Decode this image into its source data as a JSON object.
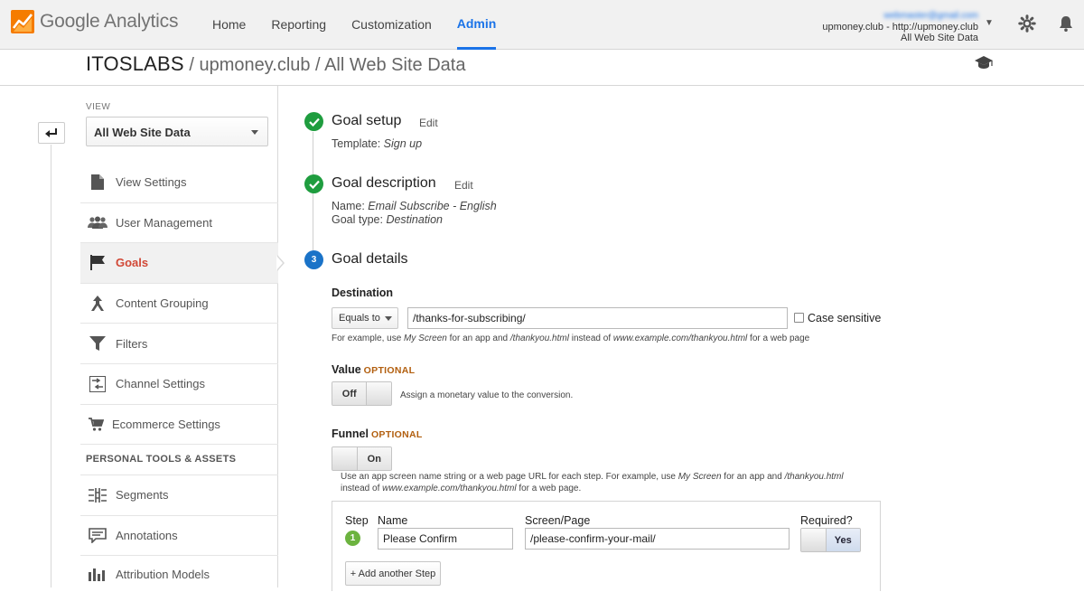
{
  "app": {
    "name_google": "Google",
    "name_product": "Analytics"
  },
  "nav": [
    "Home",
    "Reporting",
    "Customization",
    "Admin"
  ],
  "account": {
    "email": "webmaster@gmail.com",
    "property": "upmoney.club - http://upmoney.club",
    "view": "All Web Site Data"
  },
  "breadcrumb": {
    "account": "ITOSLABS",
    "rest": " / upmoney.club / All Web Site Data"
  },
  "sidebar": {
    "view_label": "VIEW",
    "view_selected": "All Web Site Data",
    "items": [
      {
        "label": "View Settings",
        "icon": "document-icon"
      },
      {
        "label": "User Management",
        "icon": "users-icon"
      },
      {
        "label": "Goals",
        "icon": "flag-icon",
        "active": true
      },
      {
        "label": "Content Grouping",
        "icon": "grouping-icon"
      },
      {
        "label": "Filters",
        "icon": "filter-icon"
      },
      {
        "label": "Channel Settings",
        "icon": "channel-icon"
      },
      {
        "label": "Ecommerce Settings",
        "icon": "cart-icon"
      }
    ],
    "section": "PERSONAL TOOLS & ASSETS",
    "tools": [
      {
        "label": "Segments",
        "icon": "segments-icon"
      },
      {
        "label": "Annotations",
        "icon": "annotation-icon"
      },
      {
        "label": "Attribution Models",
        "icon": "attribution-icon"
      }
    ]
  },
  "goal": {
    "setup": {
      "title": "Goal setup",
      "edit": "Edit",
      "template_label": "Template: ",
      "template_value": "Sign up"
    },
    "description": {
      "title": "Goal description",
      "edit": "Edit",
      "name_label": "Name: ",
      "name_value": "Email Subscribe - English",
      "type_label": "Goal type: ",
      "type_value": "Destination"
    },
    "details": {
      "number": "3",
      "title": "Goal details"
    },
    "destination": {
      "label": "Destination",
      "match": "Equals to",
      "value": "/thanks-for-subscribing/",
      "case_sensitive": "Case sensitive",
      "hint_1": "For example, use ",
      "hint_2": "My Screen",
      "hint_3": " for an app and ",
      "hint_4": "/thankyou.html",
      "hint_5": " instead of ",
      "hint_6": "www.example.com/thankyou.html",
      "hint_7": " for a web page"
    },
    "value": {
      "label": "Value",
      "optional": "OPTIONAL",
      "toggle": "Off",
      "hint": "Assign a monetary value to the conversion."
    },
    "funnel": {
      "label": "Funnel",
      "optional": "OPTIONAL",
      "toggle": "On",
      "hint_a": "Use an app screen name string or a web page URL for each step. For example, use ",
      "hint_b": "My Screen",
      "hint_c": " for an app and ",
      "hint_d": "/thankyou.html",
      "hint_e": "instead of ",
      "hint_f": "www.example.com/thankyou.html",
      "hint_g": " for a web page.",
      "col_step": "Step",
      "col_name": "Name",
      "col_screen": "Screen/Page",
      "col_required": "Required?",
      "steps": [
        {
          "number": "1",
          "name": "Please Confirm",
          "screen": "/please-confirm-your-mail/",
          "required": "Yes"
        }
      ],
      "add_step": "+ Add another Step"
    }
  },
  "colors": {
    "accent": "#1a73e8",
    "active_red": "#d14836",
    "success": "#1f9d3f",
    "optional": "#b25f0f"
  }
}
